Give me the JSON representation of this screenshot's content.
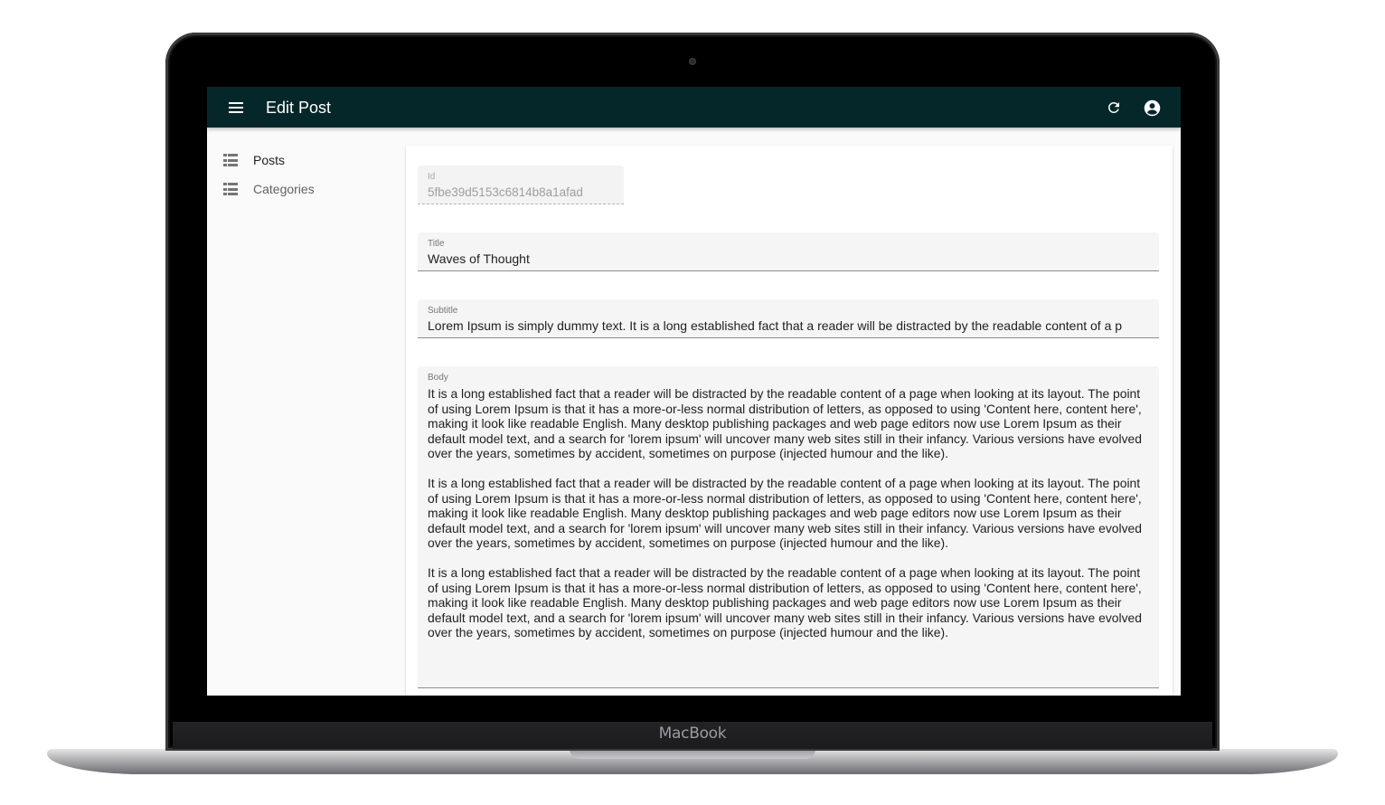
{
  "device": {
    "brand_label": "MacBook"
  },
  "appbar": {
    "title": "Edit Post",
    "background": "#06272a",
    "icons": [
      "menu-icon",
      "refresh-icon",
      "account-circle-icon"
    ]
  },
  "sidebar": {
    "items": [
      {
        "label": "Posts",
        "icon": "list-icon"
      },
      {
        "label": "Categories",
        "icon": "list-icon"
      }
    ]
  },
  "form": {
    "id": {
      "label": "Id",
      "value": "5fbe39d5153c6814b8a1afad"
    },
    "title": {
      "label": "Title",
      "value": "Waves of Thought"
    },
    "subtitle": {
      "label": "Subtitle",
      "value": "Lorem Ipsum is simply dummy text. It is a long established fact that a reader will be distracted by the readable content of a p"
    },
    "body": {
      "label": "Body",
      "paragraphs": [
        "It is a long established fact that a reader will be distracted by the readable content of a page when looking at its layout. The point of using Lorem Ipsum is that it has a more-or-less normal distribution of letters, as opposed to using 'Content here, content here', making it look like readable English. Many desktop publishing packages and web page editors now use Lorem Ipsum as their default model text, and a search for 'lorem ipsum' will uncover many web sites still in their infancy. Various versions have evolved over the years, sometimes by accident, sometimes on purpose (injected humour and the like).",
        "It is a long established fact that a reader will be distracted by the readable content of a page when looking at its layout. The point of using Lorem Ipsum is that it has a more-or-less normal distribution of letters, as opposed to using 'Content here, content here', making it look like readable English. Many desktop publishing packages and web page editors now use Lorem Ipsum as their default model text, and a search for 'lorem ipsum' will uncover many web sites still in their infancy. Various versions have evolved over the years, sometimes by accident, sometimes on purpose (injected humour and the like).",
        "It is a long established fact that a reader will be distracted by the readable content of a page when looking at its layout. The point of using Lorem Ipsum is that it has a more-or-less normal distribution of letters, as opposed to using 'Content here, content here', making it look like readable English. Many desktop publishing packages and web page editors now use Lorem Ipsum as their default model text, and a search for 'lorem ipsum' will uncover many web sites still in their infancy. Various versions have evolved over the years, sometimes by accident, sometimes on purpose (injected humour and the like)."
      ]
    }
  }
}
